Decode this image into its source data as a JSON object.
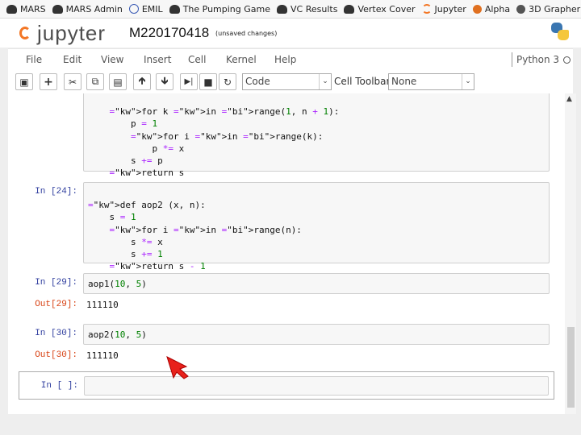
{
  "bookmarks": [
    {
      "label": "MARS",
      "icon": "car-icon"
    },
    {
      "label": "MARS Admin",
      "icon": "car-icon"
    },
    {
      "label": "EMIL",
      "icon": "globe-icon"
    },
    {
      "label": "The Pumping Game",
      "icon": "car-icon"
    },
    {
      "label": "VC Results",
      "icon": "car-icon"
    },
    {
      "label": "Vertex Cover",
      "icon": "car-icon"
    },
    {
      "label": "Jupyter",
      "icon": "jupyter-icon"
    },
    {
      "label": "Alpha",
      "icon": "gear-icon"
    },
    {
      "label": "3D Grapher",
      "icon": "ball-icon"
    }
  ],
  "header": {
    "logo_text": "jupyter",
    "notebook_name": "M220170418",
    "save_status": "(unsaved changes)"
  },
  "menu": [
    "File",
    "Edit",
    "View",
    "Insert",
    "Cell",
    "Kernel",
    "Help"
  ],
  "kernel": {
    "name": "Python 3"
  },
  "toolbar": {
    "cell_type": "Code",
    "cell_toolbar_label": "Cell Toolbar:",
    "cell_toolbar_value": "None"
  },
  "cells": {
    "c0": {
      "prompt": "",
      "lines": [
        "    for k in range(1, n + 1):",
        "        p = 1",
        "        for i in range(k):",
        "            p *= x",
        "        s += p",
        "    return s"
      ]
    },
    "c1": {
      "prompt": "In [24]:",
      "lines": [
        "def aop2 (x, n):",
        "    s = 1",
        "    for i in range(n):",
        "        s *= x",
        "        s += 1",
        "    return s - 1"
      ]
    },
    "c2": {
      "prompt": "In [29]:",
      "code": "aop1(10, 5)",
      "out_prompt": "Out[29]:",
      "output": "111110"
    },
    "c3": {
      "prompt": "In [30]:",
      "code": "aop2(10, 5)",
      "out_prompt": "Out[30]:",
      "output": "111110"
    },
    "c4": {
      "prompt": "In [ ]:",
      "code": ""
    }
  }
}
